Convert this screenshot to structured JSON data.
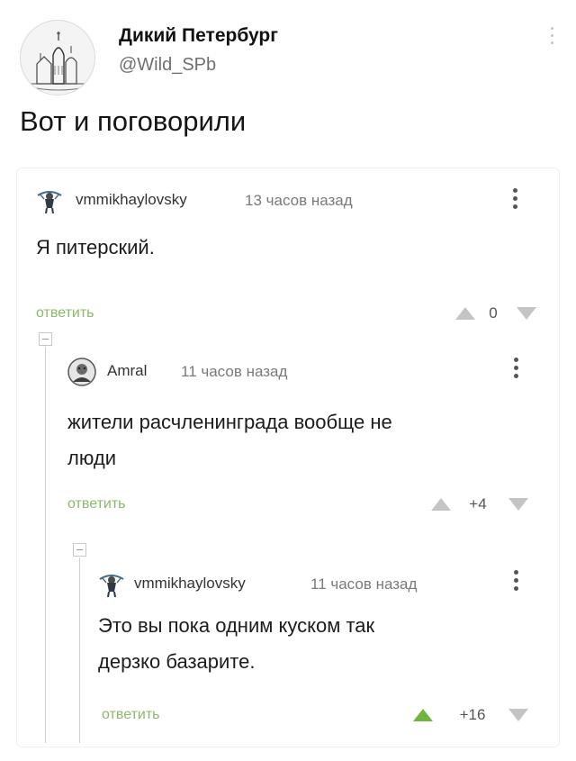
{
  "tweet": {
    "author_name": "Дикий Петербург",
    "author_handle": "@Wild_SPb",
    "text": "Вот и поговорили"
  },
  "comments": [
    {
      "author": "vmmikhaylovsky",
      "time": "13 часов назад",
      "text": "Я питерский.",
      "reply_label": "ответить",
      "score": "0",
      "upvoted": false
    },
    {
      "author": "Amral",
      "time": "11 часов назад",
      "text_lines": [
        "жители расчленинграда вообще не",
        "люди"
      ],
      "reply_label": "ответить",
      "score": "+4",
      "upvoted": false
    },
    {
      "author": "vmmikhaylovsky",
      "time": "11 часов назад",
      "text_lines": [
        "Это вы пока одним куском так",
        "дерзко базарите."
      ],
      "reply_label": "ответить",
      "score": "+16",
      "upvoted": true
    }
  ],
  "colors": {
    "reply_link": "#8cb869",
    "vote_inactive": "#c4c4c4",
    "vote_active": "#6fb43f"
  },
  "icons": {
    "tweet_avatar": "cathedral-sketch-avatar",
    "user1_avatar": "figure-avatar",
    "user2_avatar": "portrait-avatar",
    "more": "vertical-dots-icon",
    "vote_up": "triangle-up-icon",
    "vote_down": "triangle-down-icon",
    "collapse": "collapse-minus-icon"
  }
}
